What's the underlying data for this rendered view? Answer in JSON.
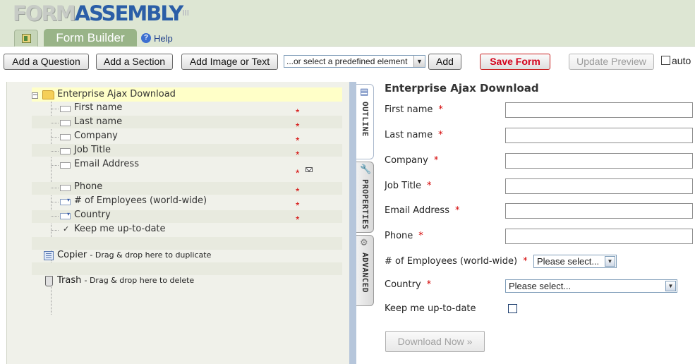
{
  "header": {
    "logo_part1": "FORM",
    "logo_part2": "ASSEMBLY",
    "logo_tm": "III",
    "home_tab_icon": "spreadsheet-icon",
    "active_tab": "Form Builder",
    "help_label": "Help",
    "help_icon": "question-circle-icon",
    "colors": {
      "header_bg": "#dde6d3",
      "active_tab_bg": "#99b488",
      "logo_blue": "#2b5ea7"
    }
  },
  "toolbar": {
    "add_question": "Add a Question",
    "add_section": "Add a Section",
    "add_image": "Add Image or Text",
    "predefined_select": "...or select a predefined element",
    "add": "Add",
    "save_form": "Save Form",
    "update_preview": "Update Preview",
    "auto_label": "auto",
    "colors": {
      "save_form_text": "#d4001a"
    }
  },
  "outline": {
    "form_title": "Enterprise Ajax Download",
    "required_mark": "*",
    "items": [
      {
        "label": "First name",
        "icon": "text-field-icon",
        "required": true
      },
      {
        "label": "Last name",
        "icon": "text-field-icon",
        "required": true
      },
      {
        "label": "Company",
        "icon": "text-field-icon",
        "required": true
      },
      {
        "label": "Job Title",
        "icon": "text-field-icon",
        "required": true
      },
      {
        "label": "Email Address",
        "icon": "text-field-icon",
        "required": true,
        "extra_icon": "envelope-icon"
      },
      {
        "label": "Phone",
        "icon": "text-field-icon",
        "required": true
      },
      {
        "label": "# of Employees (world-wide)",
        "icon": "select-field-icon",
        "required": true
      },
      {
        "label": "Country",
        "icon": "select-field-icon",
        "required": true
      },
      {
        "label": "Keep me up-to-date",
        "icon": "checkbox-icon",
        "required": false
      }
    ],
    "copier": {
      "label": "Copier",
      "hint": "- Drag & drop here to duplicate",
      "icon": "copy-icon"
    },
    "trash": {
      "label": "Trash",
      "hint": "- Drag & drop here to delete",
      "icon": "trash-icon"
    }
  },
  "side_tabs": [
    {
      "label": "OUTLINE",
      "icon": "outline-icon",
      "active": true
    },
    {
      "label": "PROPERTIES",
      "icon": "wrench-icon",
      "active": false
    },
    {
      "label": "ADVANCED",
      "icon": "gear-icon",
      "active": false
    }
  ],
  "preview": {
    "title": "Enterprise Ajax Download",
    "fields": [
      {
        "label": "First name",
        "type": "text",
        "value": ""
      },
      {
        "label": "Last name",
        "type": "text",
        "value": ""
      },
      {
        "label": "Company",
        "type": "text",
        "value": ""
      },
      {
        "label": "Job Title",
        "type": "text",
        "value": ""
      },
      {
        "label": "Email Address",
        "type": "text",
        "value": ""
      },
      {
        "label": "Phone",
        "type": "text",
        "value": ""
      },
      {
        "label": "# of Employees (world-wide)",
        "type": "select",
        "value": "Please select..."
      },
      {
        "label": "Country",
        "type": "select",
        "value": "Please select..."
      },
      {
        "label": "Keep me up-to-date",
        "type": "checkbox",
        "checked": false
      }
    ],
    "required_mark": "*",
    "submit_label": "Download Now »"
  }
}
